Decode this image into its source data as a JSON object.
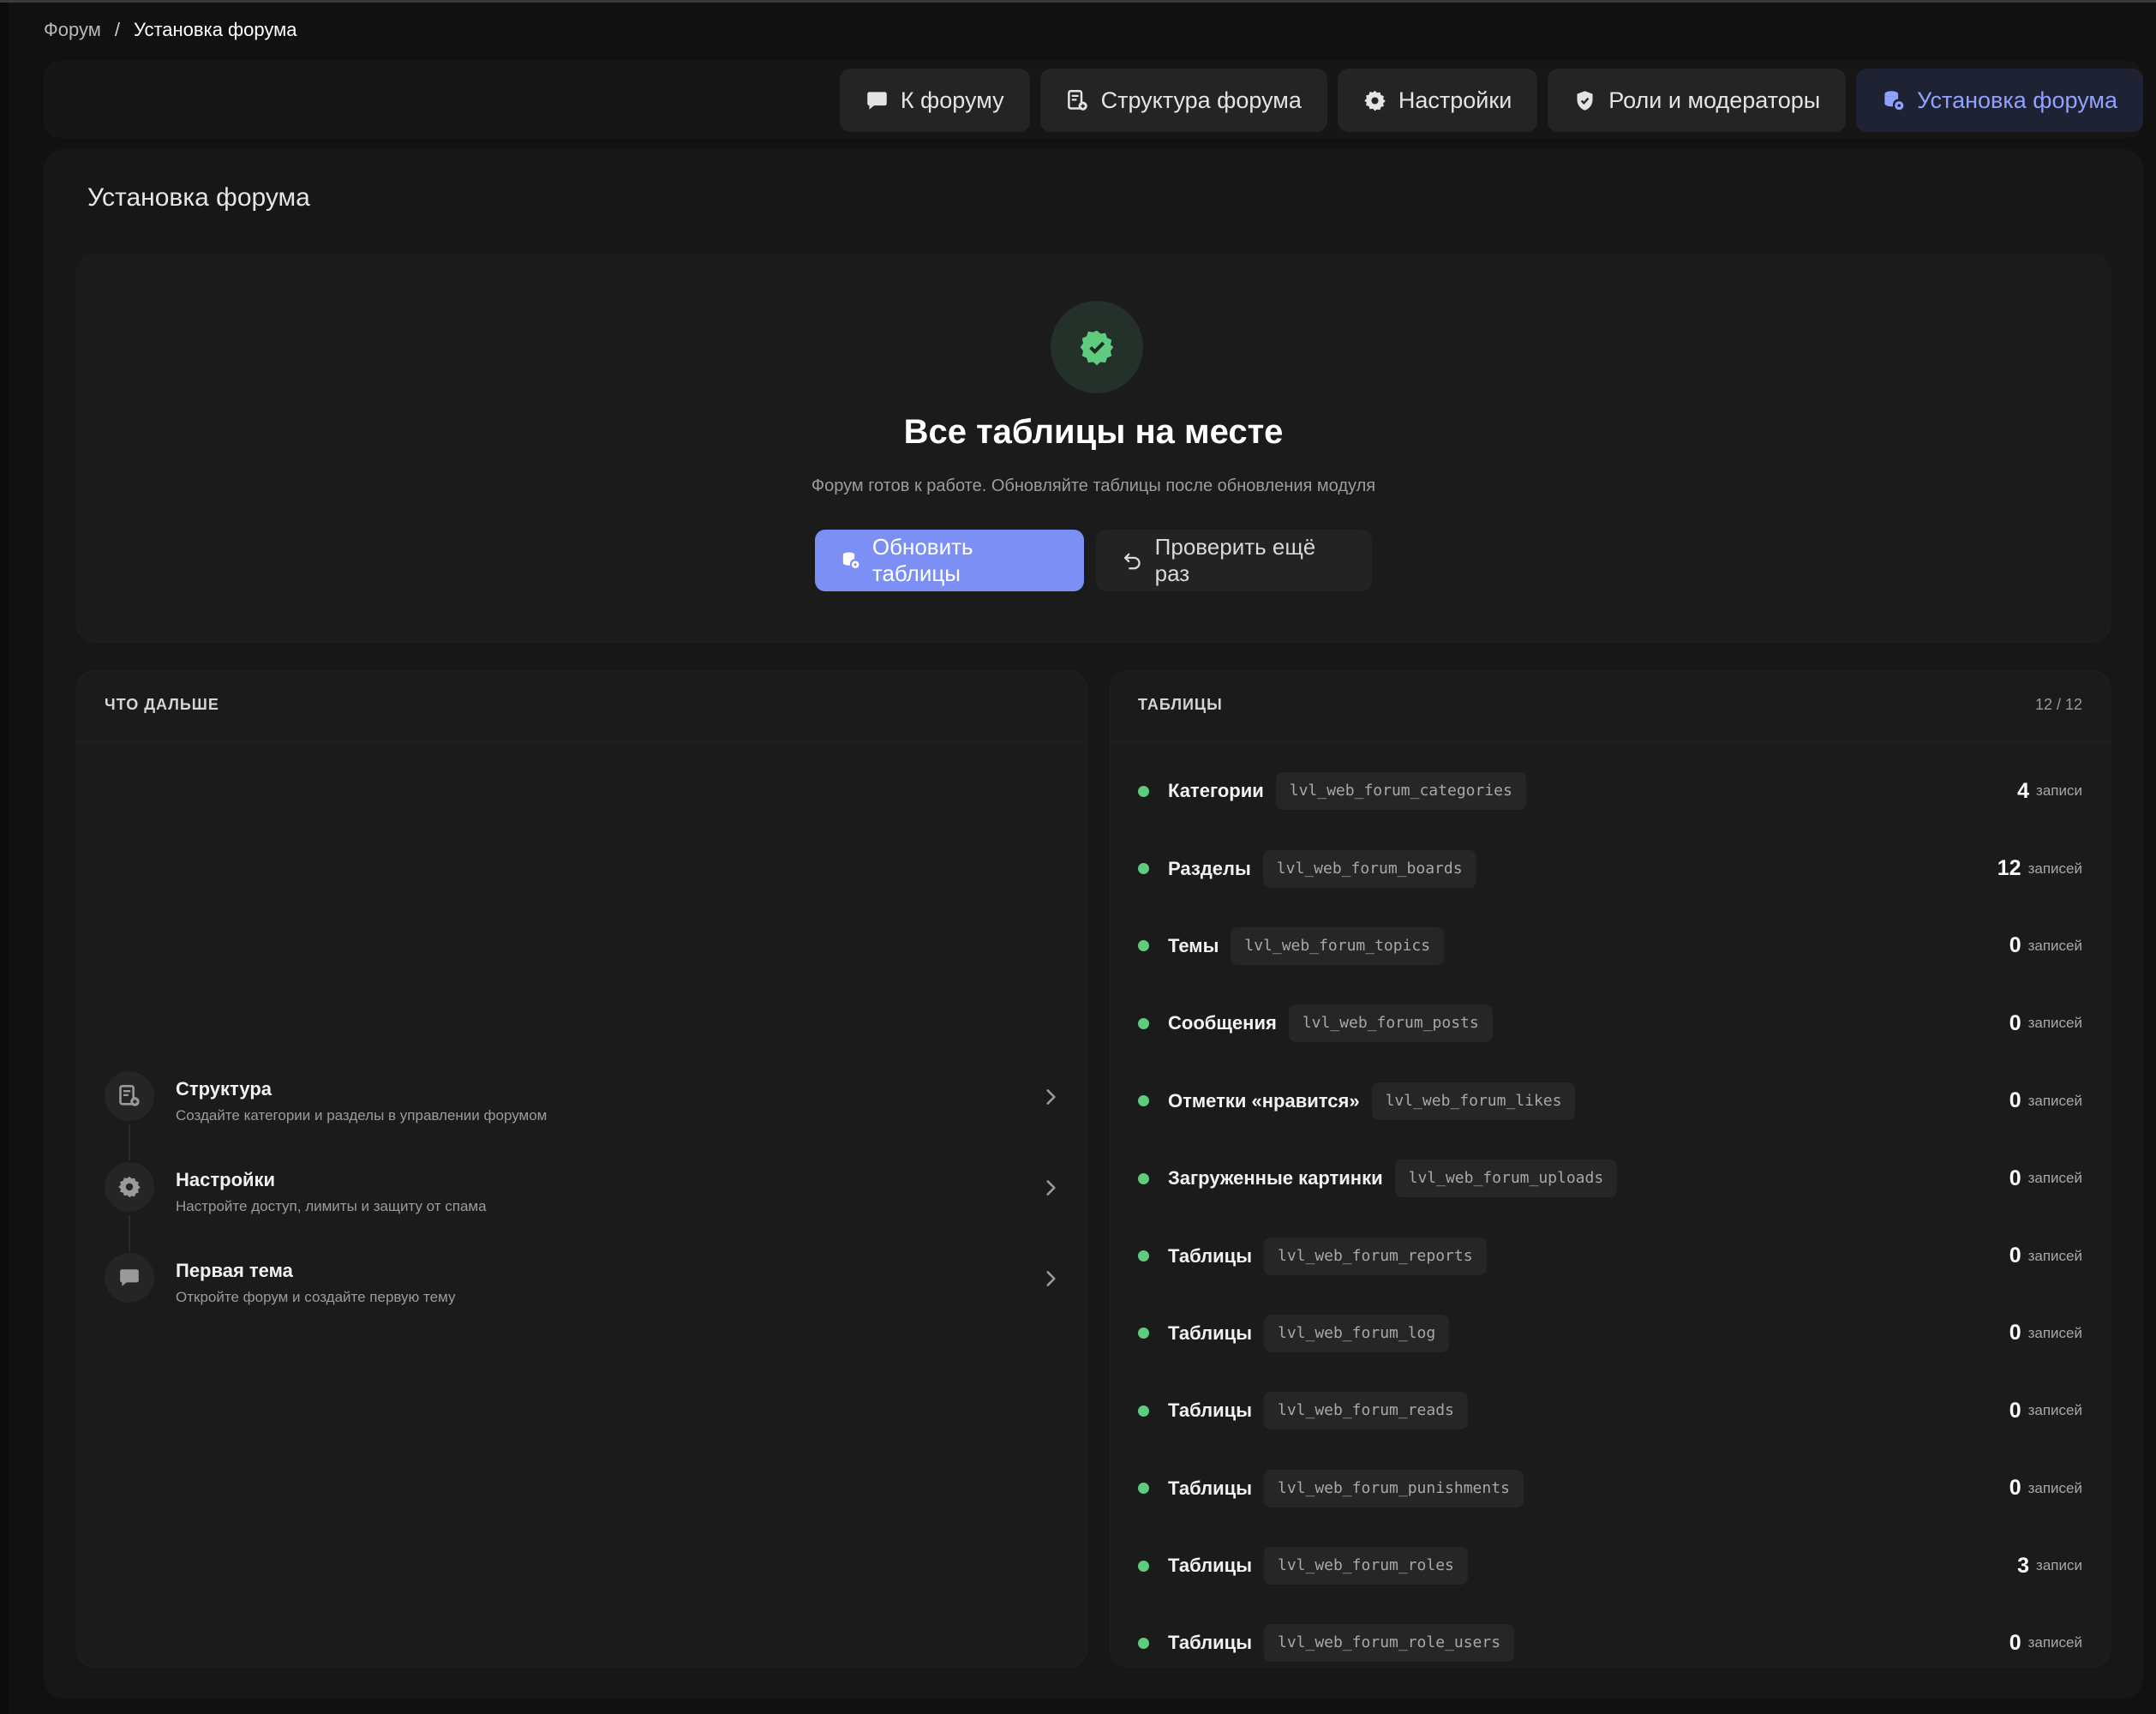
{
  "breadcrumb": {
    "root": "Форум",
    "separator": "/",
    "current": "Установка форума"
  },
  "nav": {
    "tabs": [
      {
        "label": "К форуму",
        "icon": "chat-icon"
      },
      {
        "label": "Структура форума",
        "icon": "structure-icon"
      },
      {
        "label": "Настройки",
        "icon": "gear-icon"
      },
      {
        "label": "Роли и модераторы",
        "icon": "shield-icon"
      },
      {
        "label": "Установка форума",
        "icon": "database-icon",
        "active": true
      }
    ]
  },
  "page": {
    "title": "Установка форума"
  },
  "hero": {
    "icon": "verified-badge-icon",
    "title": "Все таблицы на месте",
    "subtitle": "Форум готов к работе. Обновляйте таблицы после обновления модуля",
    "primary_button": "Обновить таблицы",
    "secondary_button": "Проверить ещё раз"
  },
  "next": {
    "title": "ЧТО ДАЛЬШЕ",
    "steps": [
      {
        "title": "Структура",
        "desc": "Создайте категории и разделы в управлении форумом",
        "icon": "structure-icon"
      },
      {
        "title": "Настройки",
        "desc": "Настройте доступ, лимиты и защиту от спама",
        "icon": "gear-icon"
      },
      {
        "title": "Первая тема",
        "desc": "Откройте форум и создайте первую тему",
        "icon": "chat-icon"
      }
    ]
  },
  "tables": {
    "title": "ТАБЛИЦЫ",
    "count": "12 / 12",
    "rows": [
      {
        "name": "Категории",
        "code": "lvl_web_forum_categories",
        "num": "4",
        "unit": "записи"
      },
      {
        "name": "Разделы",
        "code": "lvl_web_forum_boards",
        "num": "12",
        "unit": "записей"
      },
      {
        "name": "Темы",
        "code": "lvl_web_forum_topics",
        "num": "0",
        "unit": "записей"
      },
      {
        "name": "Сообщения",
        "code": "lvl_web_forum_posts",
        "num": "0",
        "unit": "записей"
      },
      {
        "name": "Отметки «нравится»",
        "code": "lvl_web_forum_likes",
        "num": "0",
        "unit": "записей"
      },
      {
        "name": "Загруженные картинки",
        "code": "lvl_web_forum_uploads",
        "num": "0",
        "unit": "записей"
      },
      {
        "name": "Таблицы",
        "code": "lvl_web_forum_reports",
        "num": "0",
        "unit": "записей"
      },
      {
        "name": "Таблицы",
        "code": "lvl_web_forum_log",
        "num": "0",
        "unit": "записей"
      },
      {
        "name": "Таблицы",
        "code": "lvl_web_forum_reads",
        "num": "0",
        "unit": "записей"
      },
      {
        "name": "Таблицы",
        "code": "lvl_web_forum_punishments",
        "num": "0",
        "unit": "записей"
      },
      {
        "name": "Таблицы",
        "code": "lvl_web_forum_roles",
        "num": "3",
        "unit": "записи"
      },
      {
        "name": "Таблицы",
        "code": "lvl_web_forum_role_users",
        "num": "0",
        "unit": "записей"
      }
    ]
  },
  "colors": {
    "accent": "#8fa2ff",
    "primary_button": "#7b8ff5",
    "status_ok": "#5ecb7e"
  }
}
